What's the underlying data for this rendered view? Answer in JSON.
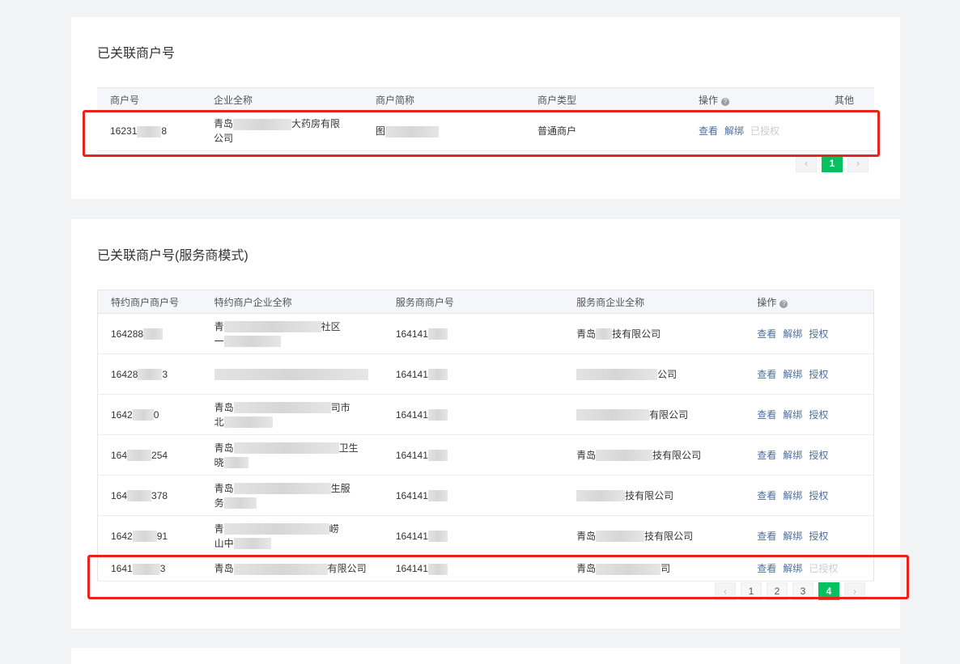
{
  "section1": {
    "title": "已关联商户号",
    "columns": [
      "商户号",
      "企业全称",
      "商户简称",
      "商户类型",
      "操作",
      "其他"
    ],
    "row": {
      "merchant_id": "16231",
      "merchant_id_tail": "8",
      "company_head": "青岛",
      "company_tail": "大药房有限",
      "company_line2": "公司",
      "short_name_head": "图",
      "type": "普通商户",
      "ops": [
        "查看",
        "解绑",
        "已授权"
      ]
    },
    "pages": [
      "1"
    ]
  },
  "section2": {
    "title": "已关联商户号(服务商模式)",
    "columns": [
      "特约商户商户号",
      "特约商户企业全称",
      "服务商商户号",
      "服务商企业全称",
      "操作"
    ],
    "rows": [
      {
        "sub_id": "164288",
        "sub_name_l1_head": "青",
        "sub_name_l1_tail": "社区",
        "sub_name_l2": "一",
        "svc_id": "164141",
        "svc_name_head": "青岛",
        "svc_name_tail": "技有限公司",
        "ops": [
          "查看",
          "解绑",
          "授权"
        ]
      },
      {
        "sub_id": "16428",
        "sub_id_tail": "3",
        "sub_name_l1_head": "",
        "sub_name_l1_tail": "",
        "sub_name_l2": "",
        "svc_id": "164141",
        "svc_name_head": "",
        "svc_name_tail": "公司",
        "ops": [
          "查看",
          "解绑",
          "授权"
        ]
      },
      {
        "sub_id": "1642",
        "sub_id_tail": "0",
        "sub_name_l1_head": "青岛",
        "sub_name_l1_tail": "司市",
        "sub_name_l2": "北",
        "svc_id": "164141",
        "svc_name_head": "",
        "svc_name_tail": "有限公司",
        "ops": [
          "查看",
          "解绑",
          "授权"
        ]
      },
      {
        "sub_id": "164",
        "sub_id_tail": "254",
        "sub_name_l1_head": "青岛",
        "sub_name_l1_tail": "卫生",
        "sub_name_l2": "晓",
        "svc_id": "164141",
        "svc_name_head": "青岛",
        "svc_name_tail": "技有限公司",
        "ops": [
          "查看",
          "解绑",
          "授权"
        ]
      },
      {
        "sub_id": "164",
        "sub_id_tail": "378",
        "sub_name_l1_head": "青岛",
        "sub_name_l1_tail": "生服",
        "sub_name_l2": "务",
        "svc_id": "164141",
        "svc_name_head": "",
        "svc_name_tail": "技有限公司",
        "ops": [
          "查看",
          "解绑",
          "授权"
        ]
      },
      {
        "sub_id": "1642",
        "sub_id_tail": "91",
        "sub_name_l1_head": "青",
        "sub_name_l1_tail": "崂",
        "sub_name_l2": "山中",
        "svc_id": "164141",
        "svc_name_head": "青岛",
        "svc_name_tail": "技有限公司",
        "ops": [
          "查看",
          "解绑",
          "授权"
        ]
      },
      {
        "sub_id": "1641",
        "sub_id_tail": "3",
        "sub_name_l1_head": "青岛",
        "sub_name_l1_tail": "有限公司",
        "sub_name_l2": "",
        "svc_id": "164141",
        "svc_name_head": "青岛",
        "svc_name_tail": "司",
        "ops": [
          "查看",
          "解绑",
          "已授权"
        ]
      }
    ],
    "pages": [
      "1",
      "2",
      "3",
      "4"
    ],
    "current_page": "4"
  },
  "icons": {
    "help": "?",
    "prev": "‹",
    "next": "›"
  },
  "colors": {
    "accent": "#07c160",
    "link": "#4d6e9c",
    "highlight": "#e8231c"
  }
}
